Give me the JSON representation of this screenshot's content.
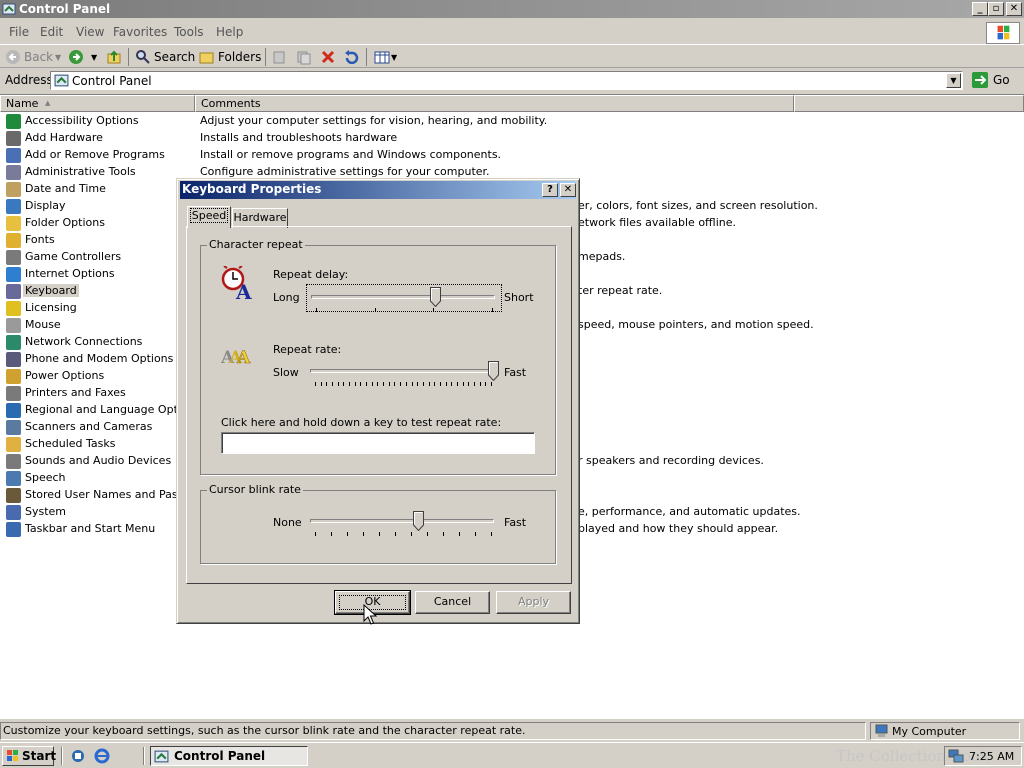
{
  "window": {
    "title": "Control Panel",
    "controls": [
      "_",
      "▫",
      "✕"
    ]
  },
  "menu": [
    "File",
    "Edit",
    "View",
    "Favorites",
    "Tools",
    "Help"
  ],
  "toolbar": {
    "back_label": "Back",
    "search_label": "Search",
    "folders_label": "Folders"
  },
  "address": {
    "label": "Address",
    "value": "Control Panel",
    "go_label": "Go"
  },
  "columns": {
    "name": "Name",
    "comments": "Comments"
  },
  "items": [
    {
      "label": "Accessibility Options",
      "icon": "accessibility-icon",
      "color": "#1f8a3b"
    },
    {
      "label": "Add Hardware",
      "icon": "add-hardware-icon",
      "color": "#6a6a6a"
    },
    {
      "label": "Add or Remove Programs",
      "icon": "add-remove-programs-icon",
      "color": "#4a6fb5"
    },
    {
      "label": "Administrative Tools",
      "icon": "admin-tools-icon",
      "color": "#7a7a9a"
    },
    {
      "label": "Date and Time",
      "icon": "date-time-icon",
      "color": "#c0a060"
    },
    {
      "label": "Display",
      "icon": "display-icon",
      "color": "#3a78c0"
    },
    {
      "label": "Folder Options",
      "icon": "folder-options-icon",
      "color": "#e8c040"
    },
    {
      "label": "Fonts",
      "icon": "fonts-icon",
      "color": "#e0b030"
    },
    {
      "label": "Game Controllers",
      "icon": "game-controller-icon",
      "color": "#7a7a7a"
    },
    {
      "label": "Internet Options",
      "icon": "internet-options-icon",
      "color": "#2f7fd0"
    },
    {
      "label": "Keyboard",
      "icon": "keyboard-icon",
      "color": "#6a6a9a"
    },
    {
      "label": "Licensing",
      "icon": "licensing-icon",
      "color": "#e0c020"
    },
    {
      "label": "Mouse",
      "icon": "mouse-icon",
      "color": "#9a9a9a"
    },
    {
      "label": "Network Connections",
      "icon": "network-connections-icon",
      "color": "#2a8a6a"
    },
    {
      "label": "Phone and Modem Options",
      "icon": "phone-modem-icon",
      "color": "#5a5a7a"
    },
    {
      "label": "Power Options",
      "icon": "power-options-icon",
      "color": "#d0a030"
    },
    {
      "label": "Printers and Faxes",
      "icon": "printer-icon",
      "color": "#7a7a7a"
    },
    {
      "label": "Regional and Language Options",
      "icon": "regional-icon",
      "color": "#2a6ab0"
    },
    {
      "label": "Scanners and Cameras",
      "icon": "scanner-icon",
      "color": "#5a7aa0"
    },
    {
      "label": "Scheduled Tasks",
      "icon": "scheduled-tasks-icon",
      "color": "#e0b040"
    },
    {
      "label": "Sounds and Audio Devices",
      "icon": "sounds-icon",
      "color": "#7a7a7a"
    },
    {
      "label": "Speech",
      "icon": "speech-icon",
      "color": "#4a7ab0"
    },
    {
      "label": "Stored User Names and Passwo",
      "icon": "stored-passwords-icon",
      "color": "#6a5a3a"
    },
    {
      "label": "System",
      "icon": "system-icon",
      "color": "#4a6ab0"
    },
    {
      "label": "Taskbar and Start Menu",
      "icon": "taskbar-start-icon",
      "color": "#3a6ab0"
    }
  ],
  "comments_full": [
    "Adjust your computer settings for vision, hearing, and mobility.",
    "Installs and troubleshoots hardware",
    "Install or remove programs and Windows components.",
    "Configure administrative settings for your computer."
  ],
  "comments_partial": [
    "er, colors, font sizes, and screen resolution.",
    "etwork files available offline.",
    "mepads.",
    "ter repeat rate.",
    "speed, mouse pointers, and motion speed.",
    "r speakers and recording devices.",
    "e, performance, and automatic updates.",
    "played and how they should appear."
  ],
  "status": {
    "text": "Customize your keyboard settings, such as the cursor blink rate and the character repeat rate.",
    "zone": "My Computer"
  },
  "taskbar": {
    "start": "Start",
    "task": "Control Panel",
    "clock": "7:25 AM",
    "watermark": "The Collection Book"
  },
  "dialog": {
    "title": "Keyboard Properties",
    "help": "?",
    "close": "✕",
    "tabs": [
      "Speed",
      "Hardware"
    ],
    "char_repeat_group": "Character repeat",
    "repeat_delay_label": "Repeat delay:",
    "long": "Long",
    "short": "Short",
    "repeat_rate_label": "Repeat rate:",
    "slow": "Slow",
    "fast": "Fast",
    "test_label": "Click here and hold down a key to test repeat rate:",
    "blink_group": "Cursor blink rate",
    "none": "None",
    "fast2": "Fast",
    "ok": "OK",
    "cancel": "Cancel",
    "apply": "Apply",
    "repeat_delay_value": 0.67,
    "repeat_rate_value": 1.0,
    "blink_rate_value": 0.58
  }
}
